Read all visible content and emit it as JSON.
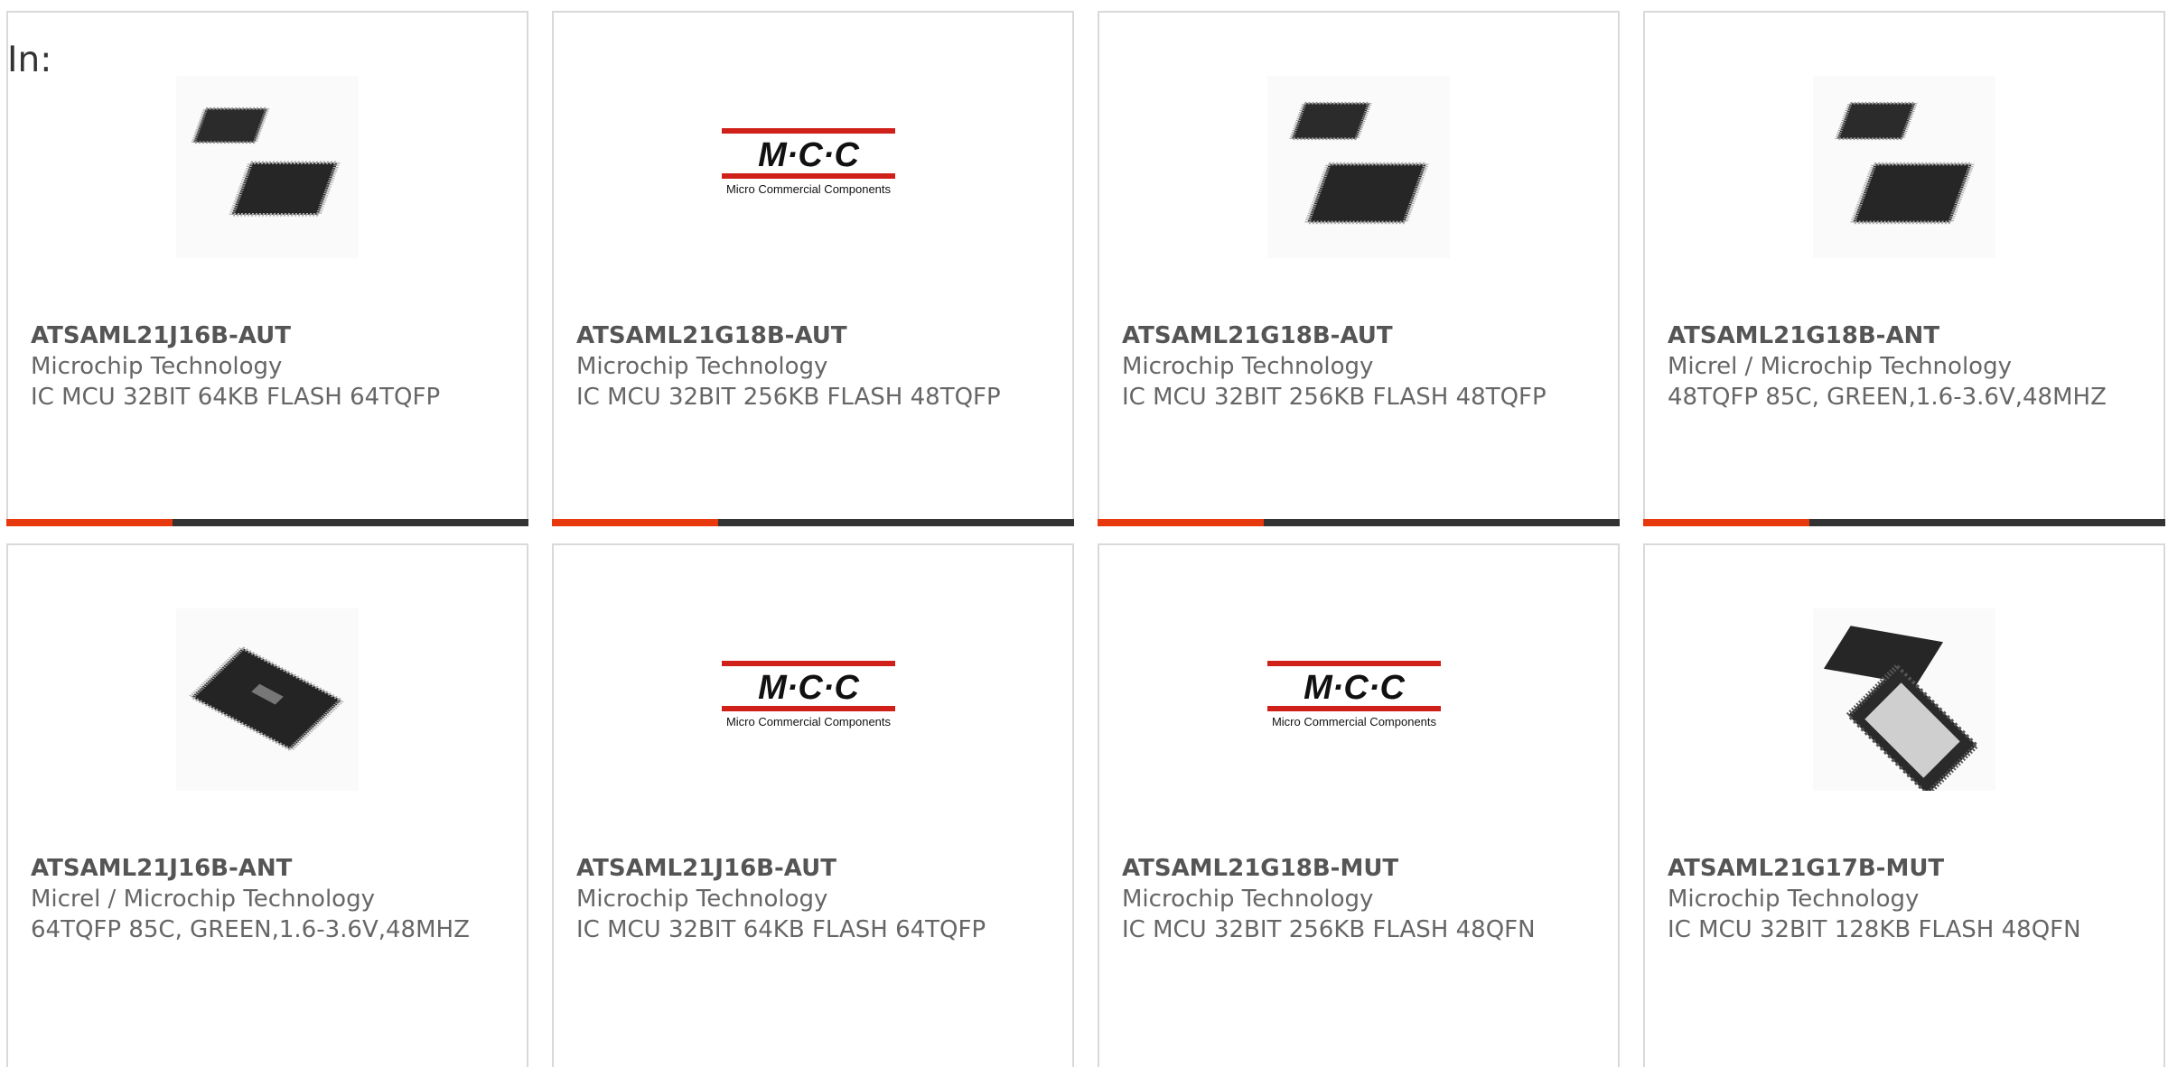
{
  "filter": {
    "label": "In:"
  },
  "theme": {
    "accent": "#e8380d",
    "bar": "#333333"
  },
  "products": [
    {
      "part": "ATSAML21J16B-AUT",
      "maker": "Microchip Technology",
      "desc": "IC MCU 32BIT 64KB FLASH 64TQFP",
      "image": "tqfp-pair-image"
    },
    {
      "part": "ATSAML21G18B-AUT",
      "maker": "Microchip Technology",
      "desc": "IC MCU 32BIT 256KB FLASH 48TQFP",
      "image": "mcc-logo"
    },
    {
      "part": "ATSAML21G18B-AUT",
      "maker": "Microchip Technology",
      "desc": "IC MCU 32BIT 256KB FLASH 48TQFP",
      "image": "tqfp-pair-image"
    },
    {
      "part": "ATSAML21G18B-ANT",
      "maker": "Micrel / Microchip Technology",
      "desc": "48TQFP 85C, GREEN,1.6-3.6V,48MHZ",
      "image": "tqfp-pair-image"
    },
    {
      "part": "ATSAML21J16B-ANT",
      "maker": "Micrel / Microchip Technology",
      "desc": "64TQFP 85C, GREEN,1.6-3.6V,48MHZ",
      "image": "tqfp-single-image"
    },
    {
      "part": "ATSAML21J16B-AUT",
      "maker": "Microchip Technology",
      "desc": "IC MCU 32BIT 64KB FLASH 64TQFP",
      "image": "mcc-logo"
    },
    {
      "part": "ATSAML21G18B-MUT",
      "maker": "Microchip Technology",
      "desc": "IC MCU 32BIT 256KB FLASH 48QFN",
      "image": "mcc-logo"
    },
    {
      "part": "ATSAML21G17B-MUT",
      "maker": "Microchip Technology",
      "desc": "IC MCU 32BIT 128KB FLASH 48QFN",
      "image": "qfn-pair-image"
    }
  ],
  "mcc_logo": {
    "letters": "M·C·C",
    "tagline": "Micro Commercial Components"
  }
}
